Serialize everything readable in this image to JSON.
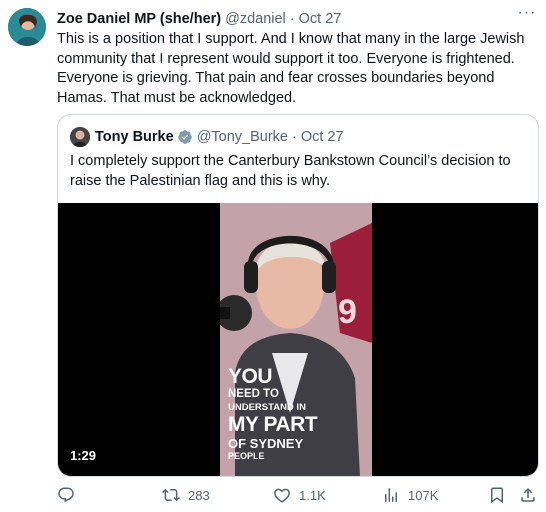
{
  "tweet": {
    "author_name": "Zoe Daniel MP (she/her)",
    "handle": "@zdaniel",
    "separator": "·",
    "date": "Oct 27",
    "more": "···",
    "text": "This is a position that I support. And I know that many in the large Jewish community that I represent would support it too. Everyone is frightened. Everyone is grieving. That pain and fear crosses boundaries beyond Hamas. That must be acknowledged."
  },
  "quote": {
    "author_name": "Tony Burke",
    "handle": "@Tony_Burke",
    "separator": "·",
    "date": "Oct 27",
    "text": "I completely support the Canterbury Bankstown Council’s decision to raise the Palestinian flag and this is why.",
    "video": {
      "duration": "1:29",
      "caption": {
        "line1": "YOU",
        "line2": "NEED TO",
        "line3": "UNDERSTAND IN",
        "line4": "MY PART",
        "line5": "OF SYDNEY",
        "line6": "PEOPLE"
      }
    }
  },
  "actions": {
    "reply": "",
    "retweets": "283",
    "likes": "1.1K",
    "views": "107K"
  },
  "colors": {
    "text": "#0f1419",
    "muted": "#536471",
    "border": "#cfd9de",
    "verified": "#829aab"
  }
}
